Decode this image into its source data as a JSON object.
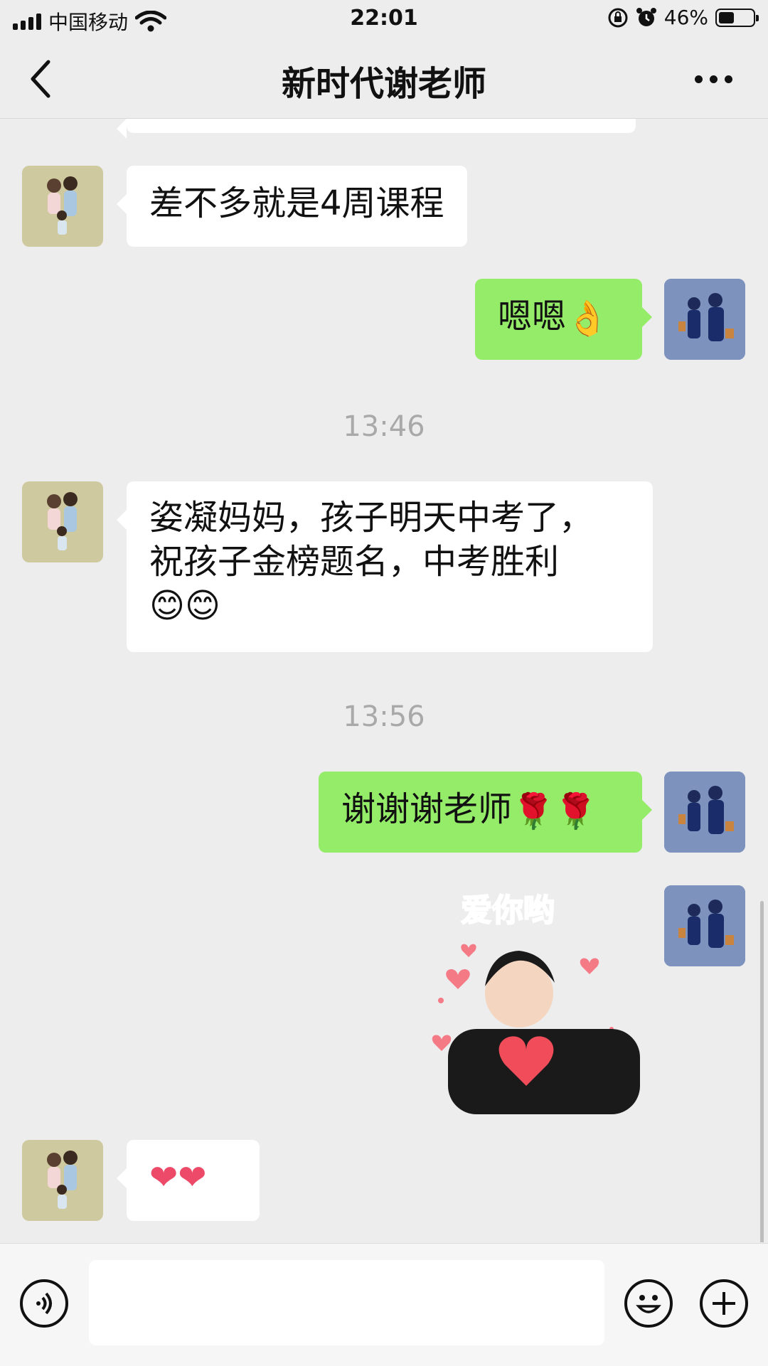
{
  "status_bar": {
    "carrier": "中国移动",
    "time": "22:01",
    "battery_percent": "46%",
    "battery_level": 0.46,
    "icons": [
      "signal-icon",
      "wifi-icon",
      "rotation-lock-icon",
      "alarm-icon",
      "battery-icon"
    ]
  },
  "nav": {
    "title": "新时代谢老师",
    "back_icon": "chevron-left-icon",
    "more_icon": "more-dots-icon"
  },
  "messages": [
    {
      "side": "left",
      "text": "差不多就是4周课程"
    },
    {
      "side": "right",
      "text": "嗯嗯",
      "emoji": "👌"
    },
    {
      "type": "timestamp",
      "text": "13:46"
    },
    {
      "side": "left",
      "text_lines": [
        "姿凝妈妈，孩子明天中考了，",
        "祝孩子金榜题名，中考胜利"
      ],
      "emoji": "😊😊"
    },
    {
      "type": "timestamp",
      "text": "13:56"
    },
    {
      "side": "right",
      "text": "谢谢谢老师",
      "emoji": "🌹🌹"
    },
    {
      "side": "right",
      "type": "sticker",
      "caption": "爱你哟"
    },
    {
      "side": "left",
      "emoji": "❤❤"
    }
  ],
  "input_bar": {
    "voice_icon": "voice-icon",
    "emoji_icon": "emoji-icon",
    "plus_icon": "plus-icon",
    "value": ""
  },
  "colors": {
    "background": "#ededed",
    "bubble_self": "#95ec69",
    "bubble_other": "#ffffff",
    "timestamp": "#a9a9a9"
  }
}
